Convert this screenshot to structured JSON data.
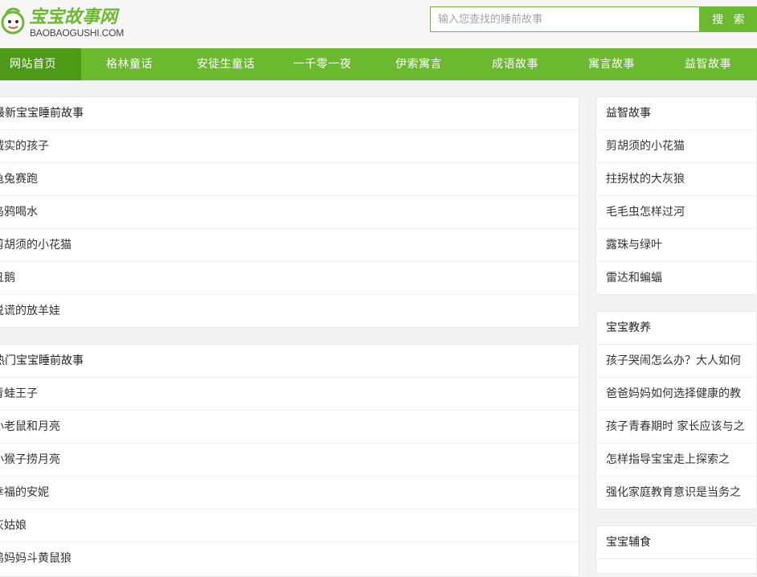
{
  "header": {
    "logo_cn": "宝宝故事网",
    "logo_en": "BAOBAOGUSHI.COM",
    "search_placeholder": "输入您查找的睡前故事",
    "search_button": "搜 索"
  },
  "nav": [
    "网站首页",
    "格林童话",
    "安徒生童话",
    "一千零一夜",
    "伊索寓言",
    "成语故事",
    "寓言故事",
    "益智故事"
  ],
  "latest": {
    "title": "最新宝宝睡前故事",
    "items": [
      "诚实的孩子",
      "龟兔赛跑",
      "乌鸦喝水",
      "剪胡须的小花猫",
      "丑鹅",
      "说谎的放羊娃"
    ]
  },
  "popular": {
    "title": "热门宝宝睡前故事",
    "items": [
      "青蛙王子",
      "小老鼠和月亮",
      "小猴子捞月亮",
      "幸福的安妮",
      "灰姑娘",
      "鸡妈妈斗黄鼠狼"
    ]
  },
  "sidebar_puzzle": {
    "title": "益智故事",
    "items": [
      "剪胡须的小花猫",
      "拄拐杖的大灰狼",
      "毛毛虫怎样过河",
      "露珠与绿叶",
      "雷达和蝙蝠"
    ]
  },
  "sidebar_parenting": {
    "title": "宝宝教养",
    "items": [
      "孩子哭闹怎么办？大人如何",
      "爸爸妈妈如何选择健康的教",
      "孩子青春期时 家长应该与之",
      "怎样指导宝宝走上探索之",
      "强化家庭教育意识是当务之"
    ]
  },
  "sidebar_food": {
    "title": "宝宝辅食"
  },
  "colors": {
    "brand": "#6bb92e",
    "nav_active": "#4d9a16"
  }
}
